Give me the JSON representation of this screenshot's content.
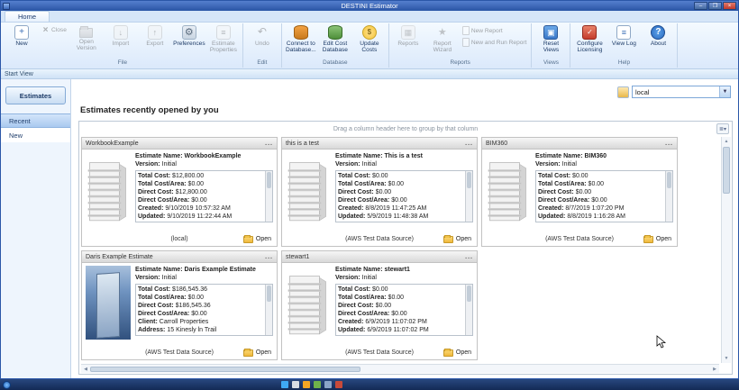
{
  "window": {
    "title": "DESTINI Estimator",
    "controls": {
      "min": "–",
      "max": "❐",
      "close": "×"
    }
  },
  "colors": {
    "titlebar": "#2a55a5",
    "ribbon_bg": "#dbe9fb",
    "selection": "#a9c9ef",
    "folder": "#f0b83a",
    "taskbar": "#132a55"
  },
  "ribbon": {
    "tab": "Home",
    "groups": [
      {
        "label": "File",
        "buttons": [
          {
            "label": "New",
            "icon": "new-document-icon"
          },
          {
            "label": "Close",
            "icon": "close-estimate-icon"
          },
          {
            "label": "Open Version",
            "icon": "open-folder-icon"
          },
          {
            "label": "Import",
            "icon": "import-icon"
          },
          {
            "label": "Export",
            "icon": "export-icon"
          },
          {
            "label": "Preferences",
            "icon": "gear-icon"
          },
          {
            "label": "Estimate Properties",
            "icon": "properties-icon"
          }
        ]
      },
      {
        "label": "Edit",
        "buttons": [
          {
            "label": "Undo",
            "icon": "undo-icon"
          }
        ]
      },
      {
        "label": "Database",
        "buttons": [
          {
            "label": "Connect to Database...",
            "icon": "database-orange-icon"
          },
          {
            "label": "Edit Cost Database",
            "icon": "database-green-icon"
          },
          {
            "label": "Update Costs",
            "icon": "coins-icon"
          }
        ]
      },
      {
        "label": "Reports",
        "buttons": [
          {
            "label": "Reports",
            "icon": "report-chart-icon"
          },
          {
            "label": "Report Wizard",
            "icon": "wizard-star-icon"
          },
          {
            "label": "New Report",
            "icon": "page-icon"
          },
          {
            "label": "New and Run Report",
            "icon": "page-run-icon"
          }
        ]
      },
      {
        "label": "Views",
        "buttons": [
          {
            "label": "Reset Views",
            "icon": "window-layout-icon"
          }
        ]
      },
      {
        "label": "Help",
        "buttons": [
          {
            "label": "Configure Licensing",
            "icon": "license-icon"
          },
          {
            "label": "View Log",
            "icon": "log-page-icon"
          },
          {
            "label": "About",
            "icon": "question-circle-icon"
          }
        ]
      }
    ]
  },
  "start_view": {
    "label": "Start View"
  },
  "sidebar": {
    "items": [
      {
        "label": "Estimates"
      },
      {
        "label": "Recent"
      },
      {
        "label": "New"
      }
    ]
  },
  "main": {
    "title": "Estimates recently opened by you",
    "group_hint": "Drag a column header here to group by that column",
    "source_selector": {
      "value": "local"
    }
  },
  "labels": {
    "estimate_name": "Estimate Name:",
    "version": "Version:",
    "open": "Open",
    "menu": "..."
  },
  "cards": [
    {
      "header": "WorkbookExample",
      "name": "WorkbookExample",
      "version": "Initial",
      "stats": [
        {
          "label": "Total Cost:",
          "value": "$12,800.00"
        },
        {
          "label": "Total Cost/Area:",
          "value": "$0.00"
        },
        {
          "label": "Direct Cost:",
          "value": "$12,800.00"
        },
        {
          "label": "Direct Cost/Area:",
          "value": "$0.00"
        },
        {
          "label": "Created:",
          "value": "9/10/2019 10:57:32 AM"
        },
        {
          "label": "Updated:",
          "value": "9/10/2019 11:22:44 AM"
        }
      ],
      "source": "(local)"
    },
    {
      "header": "this is a test",
      "name": "This is a test",
      "version": "Initial",
      "stats": [
        {
          "label": "Total Cost:",
          "value": "$0.00"
        },
        {
          "label": "Total Cost/Area:",
          "value": "$0.00"
        },
        {
          "label": "Direct Cost:",
          "value": "$0.00"
        },
        {
          "label": "Direct Cost/Area:",
          "value": "$0.00"
        },
        {
          "label": "Created:",
          "value": "8/8/2019 11:47:25 AM"
        },
        {
          "label": "Updated:",
          "value": "5/9/2019 11:48:38 AM"
        }
      ],
      "source": "(AWS Test Data Source)"
    },
    {
      "header": "BIM360",
      "name": "BIM360",
      "version": "Initial",
      "stats": [
        {
          "label": "Total Cost:",
          "value": "$0.00"
        },
        {
          "label": "Total Cost/Area:",
          "value": "$0.00"
        },
        {
          "label": "Direct Cost:",
          "value": "$0.00"
        },
        {
          "label": "Direct Cost/Area:",
          "value": "$0.00"
        },
        {
          "label": "Created:",
          "value": "8/7/2019 1:07:20 PM"
        },
        {
          "label": "Updated:",
          "value": "8/8/2019 1:16:28 AM"
        }
      ],
      "source": "(AWS Test Data Source)"
    },
    {
      "header": "Daris Example Estimate",
      "name": "Daris Example Estimate",
      "version": "Initial",
      "stats": [
        {
          "label": "Total Cost:",
          "value": "$186,545.36"
        },
        {
          "label": "Total Cost/Area:",
          "value": "$0.00"
        },
        {
          "label": "Direct Cost:",
          "value": "$186,545.36"
        },
        {
          "label": "Direct Cost/Area:",
          "value": "$0.00"
        },
        {
          "label": "Client:",
          "value": "Carroll Properties"
        },
        {
          "label": "Address:",
          "value": "15 Kinesly ln Trail"
        }
      ],
      "source": "(AWS Test Data Source)"
    },
    {
      "header": "stewart1",
      "name": "stewart1",
      "version": "Initial",
      "stats": [
        {
          "label": "Total Cost:",
          "value": "$0.00"
        },
        {
          "label": "Total Cost/Area:",
          "value": "$0.00"
        },
        {
          "label": "Direct Cost:",
          "value": "$0.00"
        },
        {
          "label": "Direct Cost/Area:",
          "value": "$0.00"
        },
        {
          "label": "Created:",
          "value": "6/9/2019 11:07:02 PM"
        },
        {
          "label": "Updated:",
          "value": "6/9/2019 11:07:02 PM"
        }
      ],
      "source": "(AWS Test Data Source)"
    }
  ]
}
